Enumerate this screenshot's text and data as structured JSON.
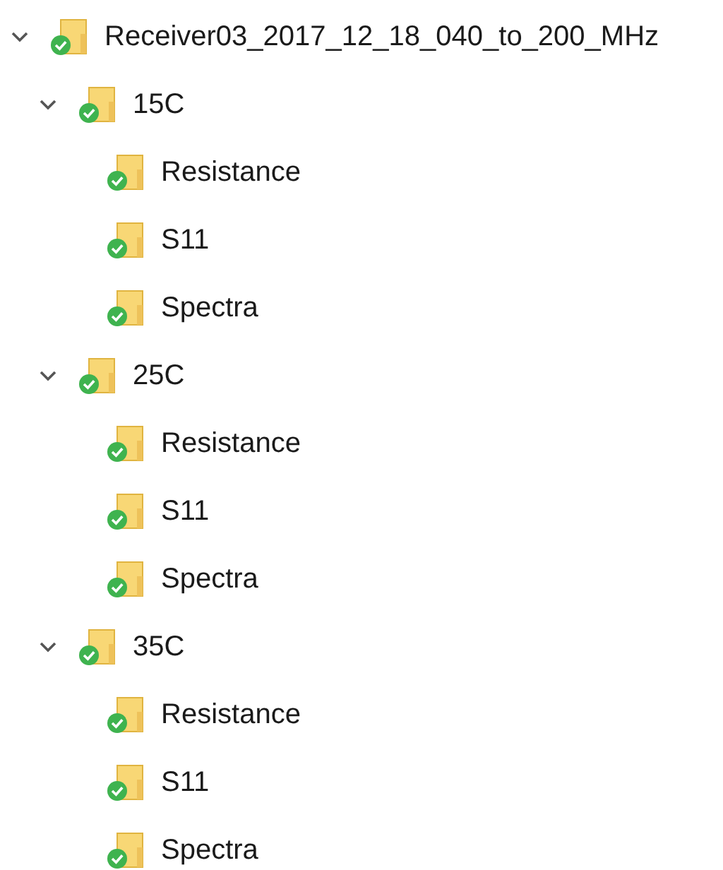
{
  "tree": [
    {
      "label": "Receiver03_2017_12_18_040_to_200_MHz",
      "expanded": true,
      "children": [
        {
          "label": "15C",
          "expanded": true,
          "children": [
            {
              "label": "Resistance"
            },
            {
              "label": "S11"
            },
            {
              "label": "Spectra"
            }
          ]
        },
        {
          "label": "25C",
          "expanded": true,
          "children": [
            {
              "label": "Resistance"
            },
            {
              "label": "S11"
            },
            {
              "label": "Spectra"
            }
          ]
        },
        {
          "label": "35C",
          "expanded": true,
          "children": [
            {
              "label": "Resistance"
            },
            {
              "label": "S11"
            },
            {
              "label": "Spectra"
            }
          ]
        }
      ]
    }
  ]
}
